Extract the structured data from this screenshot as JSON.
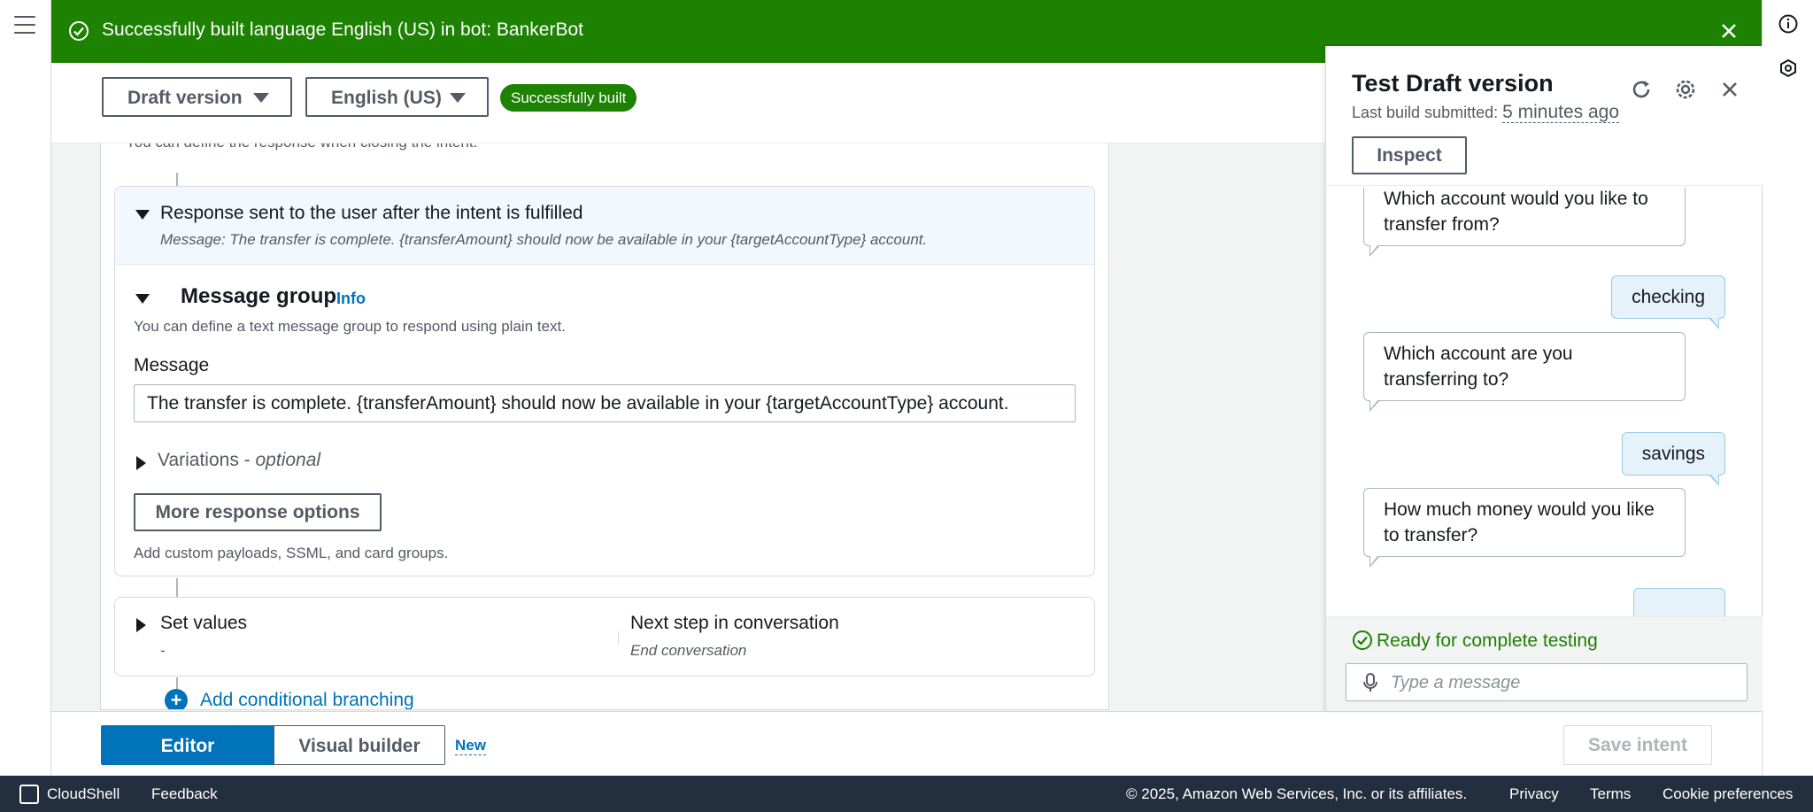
{
  "flash": {
    "message": "Successfully built language English (US) in bot: BankerBot",
    "color": "#1d8102"
  },
  "header": {
    "version_dropdown": "Draft version",
    "language_dropdown": "English (US)",
    "build_status": "Successfully built"
  },
  "intent": {
    "faded_text": "You can define the response when closing the intent.",
    "response_title": "Response sent to the user after the intent is fulfilled",
    "response_message": "Message: The transfer is complete. {transferAmount} should now be available in your {targetAccountType} account.",
    "message_group_title": "Message group",
    "info_link": "Info",
    "message_group_desc": "You can define a text message group to respond using plain text.",
    "message_label": "Message",
    "message_value": "The transfer is complete. {transferAmount} should now be available in your {targetAccountType} account.",
    "variations_label": "Variations - ",
    "variations_optional": "optional",
    "more_options_button": "More response options",
    "more_options_desc": "Add custom payloads, SSML, and card groups.",
    "set_values_title": "Set values",
    "set_values_value": "-",
    "next_step_title": "Next step in conversation",
    "next_step_value": "End conversation",
    "add_branching": "Add conditional branching"
  },
  "bottom_bar": {
    "editor_tab": "Editor",
    "visual_builder_tab": "Visual builder",
    "new_badge": "New",
    "save_button": "Save intent"
  },
  "test_panel": {
    "title": "Test Draft version",
    "last_build_label": "Last build submitted: ",
    "last_build_time": "5 minutes ago",
    "inspect_button": "Inspect",
    "messages": [
      {
        "from": "bot",
        "text": "Which account would you like to transfer from?"
      },
      {
        "from": "user",
        "text": "checking"
      },
      {
        "from": "bot",
        "text": "Which account are you transferring to?"
      },
      {
        "from": "user",
        "text": "savings"
      },
      {
        "from": "bot",
        "text": "How much money would you like to transfer?"
      }
    ],
    "ready_status": "Ready for complete testing",
    "input_placeholder": "Type a message",
    "icons": [
      "refresh-icon",
      "settings-icon",
      "close-icon",
      "microphone-icon"
    ]
  },
  "footer": {
    "cloudshell": "CloudShell",
    "feedback": "Feedback",
    "copyright": "© 2025, Amazon Web Services, Inc. or its affiliates.",
    "privacy": "Privacy",
    "terms": "Terms",
    "cookie": "Cookie preferences"
  }
}
